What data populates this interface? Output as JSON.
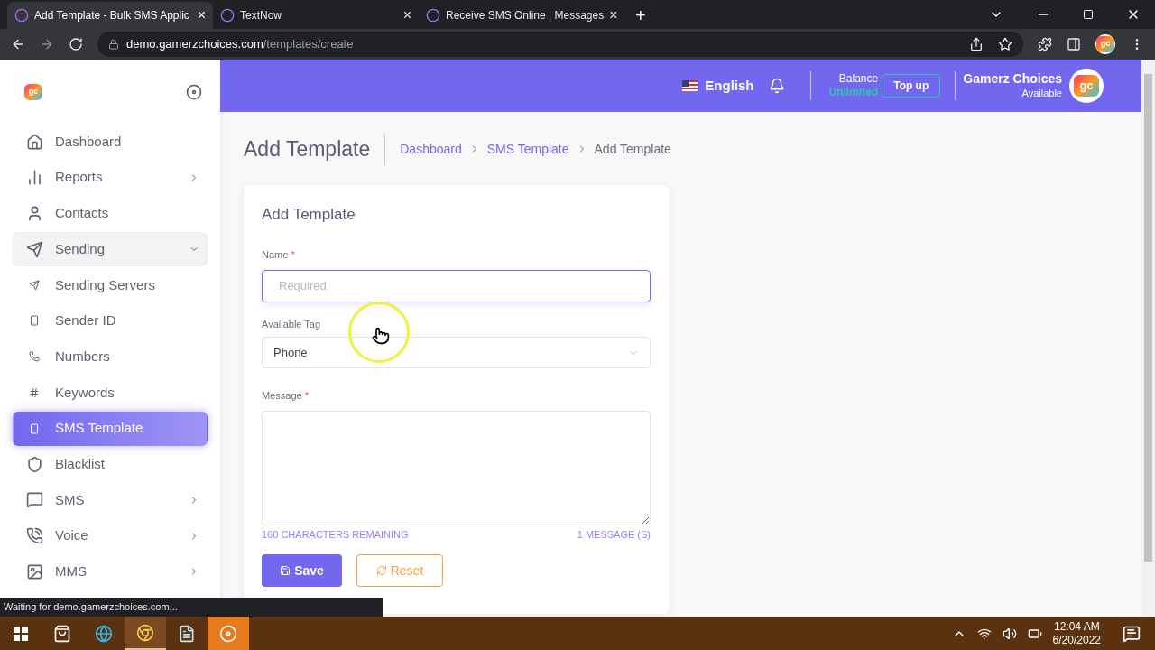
{
  "browser": {
    "tabs": [
      {
        "title": "Add Template - Bulk SMS Applic",
        "selected": true,
        "close": "×"
      },
      {
        "title": "TextNow",
        "selected": false,
        "close": "×"
      },
      {
        "title": "Receive SMS Online | Messages",
        "selected": false,
        "close": "×"
      }
    ],
    "profile_logo": "gc",
    "new_tab": "+",
    "url_host": "demo.gamerzchoices.com",
    "url_path": "/templates/create",
    "status": "Waiting for demo.gamerzchoices.com..."
  },
  "header": {
    "language": "English",
    "balance_label": "Balance",
    "balance_value": "Unlimited",
    "topup": "Top up",
    "user_name": "Gamerz Choices",
    "user_status": "Available",
    "avatar": "gc"
  },
  "sidebar": {
    "logo": "gc",
    "items": [
      {
        "label": "Dashboard",
        "kind": "item",
        "expandable": false,
        "expanded": false,
        "selected": false
      },
      {
        "label": "Reports",
        "kind": "item",
        "expandable": true,
        "expanded": false,
        "selected": false
      },
      {
        "label": "Contacts",
        "kind": "item",
        "expandable": false,
        "expanded": false,
        "selected": false
      },
      {
        "label": "Sending",
        "kind": "item",
        "expandable": true,
        "expanded": true,
        "selected": false
      },
      {
        "label": "Sending Servers",
        "kind": "sub",
        "expandable": false,
        "expanded": false,
        "selected": false
      },
      {
        "label": "Sender ID",
        "kind": "sub",
        "expandable": false,
        "expanded": false,
        "selected": false
      },
      {
        "label": "Numbers",
        "kind": "sub",
        "expandable": false,
        "expanded": false,
        "selected": false
      },
      {
        "label": "Keywords",
        "kind": "sub",
        "expandable": false,
        "expanded": false,
        "selected": false
      },
      {
        "label": "SMS Template",
        "kind": "sub",
        "expandable": false,
        "expanded": false,
        "selected": true
      },
      {
        "label": "Blacklist",
        "kind": "item",
        "expandable": false,
        "expanded": false,
        "selected": false
      },
      {
        "label": "SMS",
        "kind": "item",
        "expandable": true,
        "expanded": false,
        "selected": false
      },
      {
        "label": "Voice",
        "kind": "item",
        "expandable": true,
        "expanded": false,
        "selected": false
      },
      {
        "label": "MMS",
        "kind": "item",
        "expandable": true,
        "expanded": false,
        "selected": false
      }
    ]
  },
  "page": {
    "title": "Add Template",
    "breadcrumb": [
      {
        "label": "Dashboard",
        "link": true
      },
      {
        "label": "SMS Template",
        "link": true
      },
      {
        "label": "Add Template",
        "link": false
      }
    ]
  },
  "form": {
    "title": "Add Template",
    "name": {
      "label": "Name",
      "required_mark": "*",
      "placeholder": "Required"
    },
    "tag": {
      "label": "Available Tag",
      "value": "Phone"
    },
    "message": {
      "label": "Message",
      "required_mark": "*"
    },
    "remaining": "160 CHARACTERS REMAINING",
    "messages": "1 MESSAGE (S)",
    "save": "Save",
    "reset": "Reset"
  },
  "taskbar": {
    "time": "12:04 AM",
    "date": "6/20/2022"
  }
}
